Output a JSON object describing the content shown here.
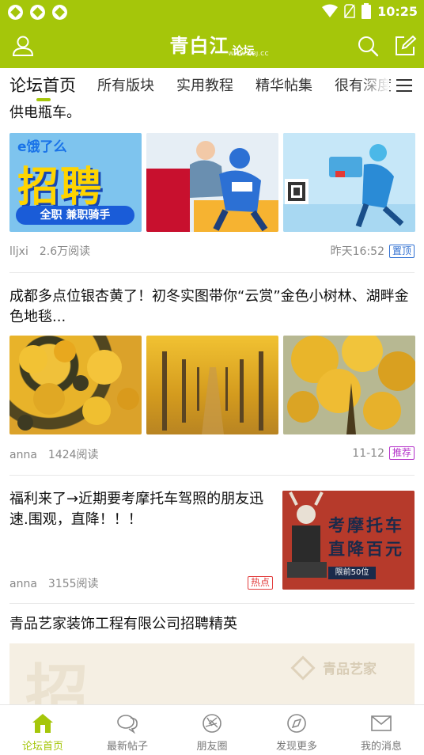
{
  "status_bar": {
    "time": "10:25"
  },
  "app_bar": {
    "title": "青白江",
    "title_suffix": "论坛",
    "url": "WWW.QBJ.CC",
    "profile_icon": "user-icon",
    "search_icon": "search-icon",
    "compose_icon": "edit-icon"
  },
  "tabs": [
    {
      "label": "论坛首页",
      "active": true
    },
    {
      "label": "所有版块"
    },
    {
      "label": "实用教程"
    },
    {
      "label": "精华帖集"
    },
    {
      "label": "很有深度"
    }
  ],
  "posts": [
    {
      "title": "供电瓶车。",
      "images": [
        "recruit-poster",
        "delivery-rider-comic",
        "rider-qr-poster"
      ],
      "image_text": {
        "brand": "e饿了么",
        "headline": "招聘",
        "sub": "全职 兼职骑手"
      },
      "author": "lljxi",
      "views": "2.6万阅读",
      "time": "昨天16:52",
      "badge": "置顶"
    },
    {
      "title": "成都多点位银杏黄了！初冬实图带你“云赏”金色小树林、湖畔金色地毯...",
      "images": [
        "ginkgo-leaves",
        "ginkgo-avenue",
        "ginkgo-tree"
      ],
      "author": "anna",
      "views": "1424阅读",
      "time": "11-12",
      "badge": "推荐"
    },
    {
      "title": "福利来了→近期要考摩托车驾照的朋友迅速.围观，直降！！！",
      "image_text": {
        "line1": "考摩托车",
        "line2": "直降百元",
        "tag": "限前50位"
      },
      "author": "anna",
      "views": "3155阅读",
      "badge": "热点"
    },
    {
      "title": "青品艺家装饰工程有限公司招聘精英",
      "image_text": {
        "big": "招",
        "brand": "青品艺家"
      }
    }
  ],
  "bottom_nav": [
    {
      "label": "论坛首页",
      "icon": "home-icon",
      "active": true
    },
    {
      "label": "最新帖子",
      "icon": "chat-bubbles-icon"
    },
    {
      "label": "朋友圈",
      "icon": "friends-circle-icon"
    },
    {
      "label": "发现更多",
      "icon": "compass-icon"
    },
    {
      "label": "我的消息",
      "icon": "mail-icon"
    }
  ],
  "colors": {
    "accent": "#a5c60a",
    "top_badge": "#2f6fd1",
    "recommend_badge": "#b32fc8",
    "hot_badge": "#e23d3d"
  }
}
